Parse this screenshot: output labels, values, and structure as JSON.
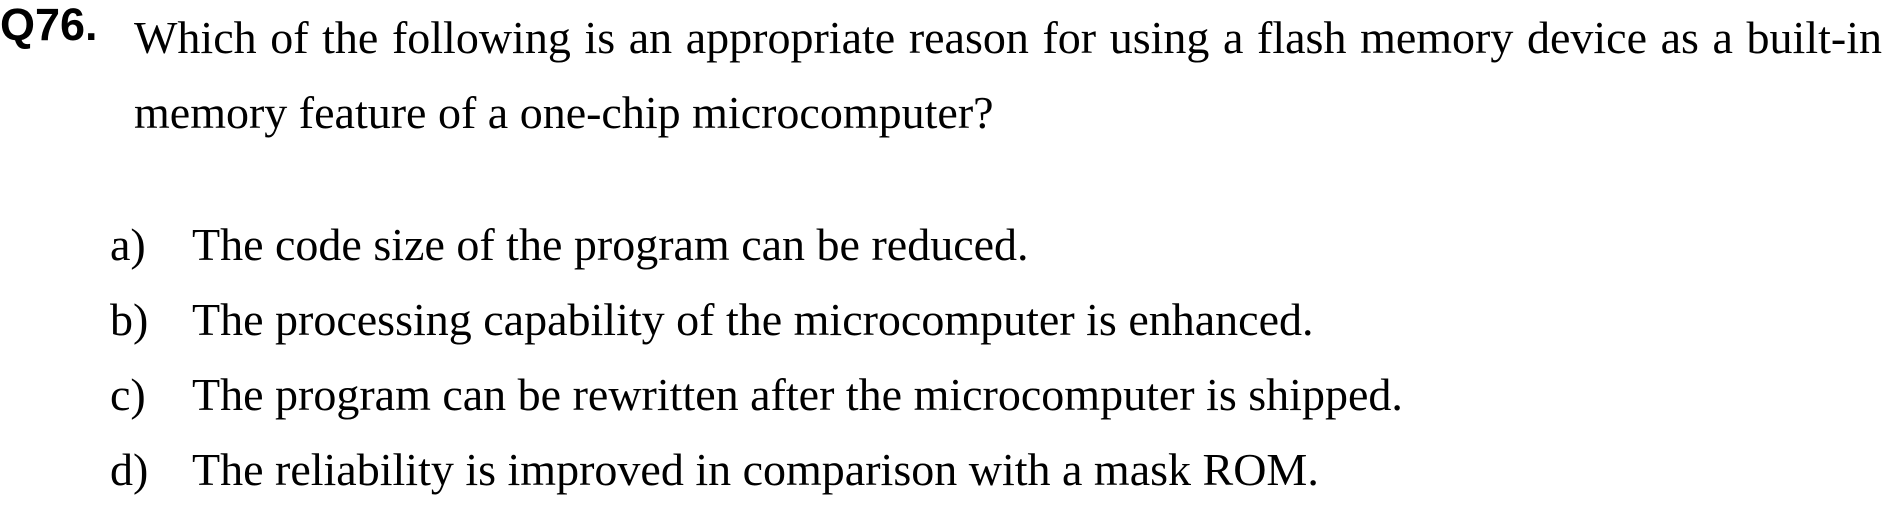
{
  "question": {
    "number": "Q76.",
    "text": "Which of the following is an appropriate reason for using a flash memory device as a built-in memory feature of a one-chip microcomputer?"
  },
  "options": [
    {
      "letter": "a)",
      "text": "The code size of the program can be reduced."
    },
    {
      "letter": "b)",
      "text": "The processing capability of the microcomputer is enhanced."
    },
    {
      "letter": "c)",
      "text": "The program can be rewritten after the microcomputer is shipped."
    },
    {
      "letter": "d)",
      "text": "The reliability is improved in comparison with a mask ROM."
    }
  ]
}
